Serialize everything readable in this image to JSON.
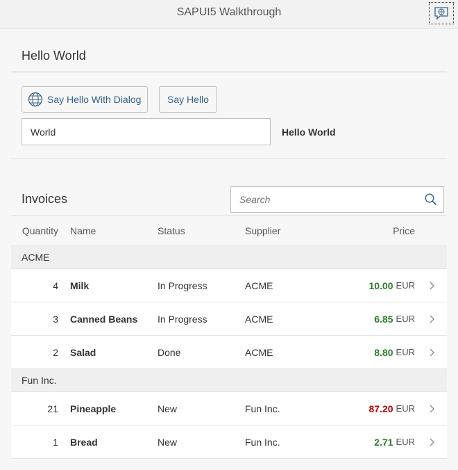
{
  "shell": {
    "title": "SAPUI5 Walkthrough",
    "help_icon": "comment-help-icon"
  },
  "panel": {
    "title": "Hello World",
    "dialog_button": "Say Hello With Dialog",
    "dialog_icon": "world-icon",
    "hello_button": "Say Hello",
    "name_value": "World",
    "greeting": "Hello World"
  },
  "invoices": {
    "title": "Invoices",
    "search_placeholder": "Search",
    "columns": {
      "quantity": "Quantity",
      "name": "Name",
      "status": "Status",
      "supplier": "Supplier",
      "price": "Price"
    },
    "groups": [
      {
        "name": "ACME",
        "rows": [
          {
            "quantity": "4",
            "name": "Milk",
            "status": "In Progress",
            "supplier": "ACME",
            "price": "10.00",
            "currency": "EUR",
            "state": "good"
          },
          {
            "quantity": "3",
            "name": "Canned Beans",
            "status": "In Progress",
            "supplier": "ACME",
            "price": "6.85",
            "currency": "EUR",
            "state": "good"
          },
          {
            "quantity": "2",
            "name": "Salad",
            "status": "Done",
            "supplier": "ACME",
            "price": "8.80",
            "currency": "EUR",
            "state": "good"
          }
        ]
      },
      {
        "name": "Fun Inc.",
        "rows": [
          {
            "quantity": "21",
            "name": "Pineapple",
            "status": "New",
            "supplier": "Fun Inc.",
            "price": "87.20",
            "currency": "EUR",
            "state": "bad"
          },
          {
            "quantity": "1",
            "name": "Bread",
            "status": "New",
            "supplier": "Fun Inc.",
            "price": "2.71",
            "currency": "EUR",
            "state": "good"
          }
        ]
      }
    ]
  },
  "colors": {
    "good": "#2b7d2b",
    "bad": "#bb0000",
    "button_text": "#346187"
  }
}
